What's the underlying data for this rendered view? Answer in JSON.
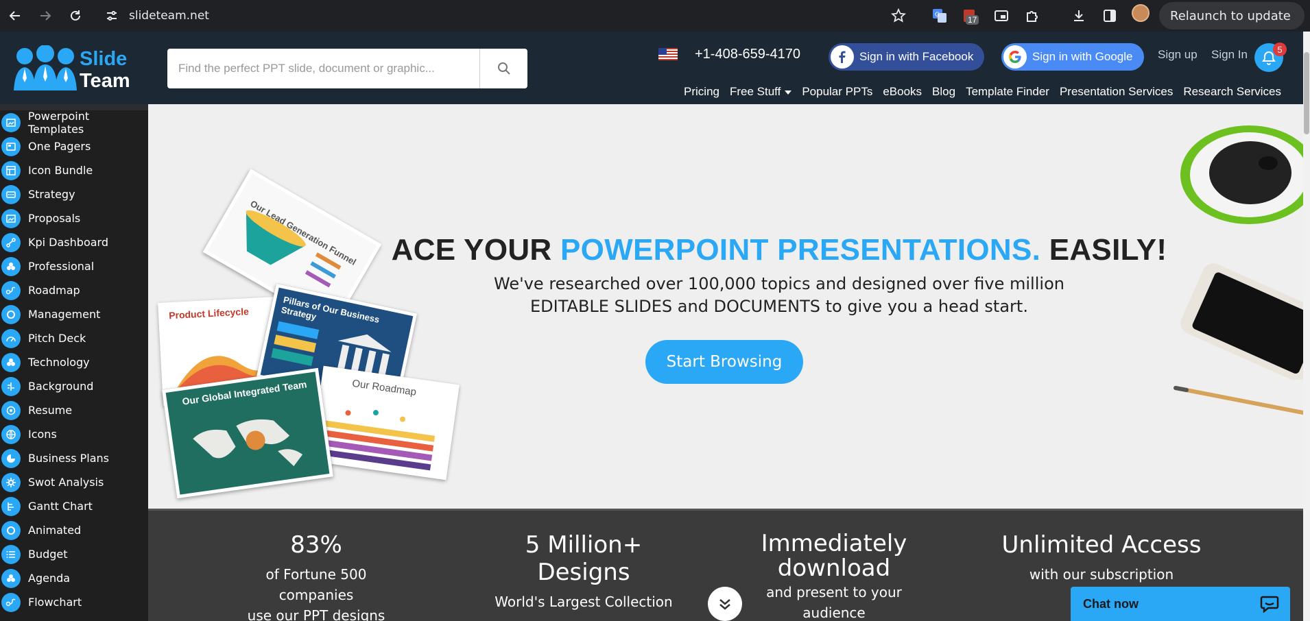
{
  "browser": {
    "url": "slideteam.net",
    "relaunch_label": "Relaunch to update",
    "extension_badge": "17"
  },
  "header": {
    "logo_word1": "Slide",
    "logo_word2": "Team",
    "search_placeholder": "Find the perfect PPT slide, document or graphic...",
    "phone": "+1-408-659-4170",
    "facebook_label": "Sign in with Facebook",
    "google_label": "Sign in with Google",
    "signup_label": "Sign up",
    "signin_label": "Sign In",
    "notification_count": "5",
    "nav": [
      "Pricing",
      "Free Stuff",
      "Popular PPTs",
      "eBooks",
      "Blog",
      "Template Finder",
      "Presentation Services",
      "Research Services"
    ]
  },
  "sidebar": {
    "items": [
      {
        "label": "Powerpoint Templates",
        "icon": "template-icon"
      },
      {
        "label": "One Pagers",
        "icon": "one-pager-icon"
      },
      {
        "label": "Icon Bundle",
        "icon": "icon-bundle-icon"
      },
      {
        "label": "Strategy",
        "icon": "strategy-icon"
      },
      {
        "label": "Proposals",
        "icon": "proposal-icon"
      },
      {
        "label": "Kpi Dashboard",
        "icon": "kpi-icon"
      },
      {
        "label": "Professional",
        "icon": "professional-icon"
      },
      {
        "label": "Roadmap",
        "icon": "roadmap-icon"
      },
      {
        "label": "Management",
        "icon": "management-icon"
      },
      {
        "label": "Pitch Deck",
        "icon": "gauge-icon"
      },
      {
        "label": "Technology",
        "icon": "technology-icon"
      },
      {
        "label": "Background",
        "icon": "background-icon"
      },
      {
        "label": "Resume",
        "icon": "target-icon"
      },
      {
        "label": "Icons",
        "icon": "globe-icon"
      },
      {
        "label": "Business Plans",
        "icon": "pie-icon"
      },
      {
        "label": "Swot Analysis",
        "icon": "gear-icon"
      },
      {
        "label": "Gantt Chart",
        "icon": "gantt-icon"
      },
      {
        "label": "Animated",
        "icon": "animated-icon"
      },
      {
        "label": "Budget",
        "icon": "list-icon"
      },
      {
        "label": "Agenda",
        "icon": "agenda-icon"
      },
      {
        "label": "Flowchart",
        "icon": "flowchart-icon"
      }
    ]
  },
  "hero": {
    "title_part1": "ACE YOUR ",
    "title_part2": "POWERPOINT PRESENTATIONS.",
    "title_part3": " EASILY!",
    "subtitle_line1": "We've researched over 100,000 topics and designed over five million",
    "subtitle_line2": "EDITABLE SLIDES and DOCUMENTS to give you a head start.",
    "cta": "Start Browsing",
    "cards": {
      "funnel": "Our Lead Generation Funnel",
      "lifecycle": "Product Lifecycle",
      "pillars": "Pillars of Our Business Strategy",
      "team": "Our Global Integrated Team",
      "roadmap": "Our Roadmap"
    }
  },
  "stats": [
    {
      "big": "83%",
      "small_line1": "of Fortune 500 companies",
      "small_line2": "use our PPT designs"
    },
    {
      "big": "5 Million+ Designs",
      "small_line1": "World's Largest Collection",
      "small_line2": ""
    },
    {
      "big_line1": "Immediately",
      "big_line2": "download",
      "small_line1": "and present to your audience"
    },
    {
      "big": "Unlimited Access",
      "small_line1": "with our subscription",
      "small_line2": ""
    }
  ],
  "chat": {
    "label": "Chat now"
  },
  "colors": {
    "accent": "#2aa7f5",
    "header_bg": "#1c2833",
    "sidebar_bg": "#1f1f1f",
    "stats_bg": "#3b3b3b"
  }
}
